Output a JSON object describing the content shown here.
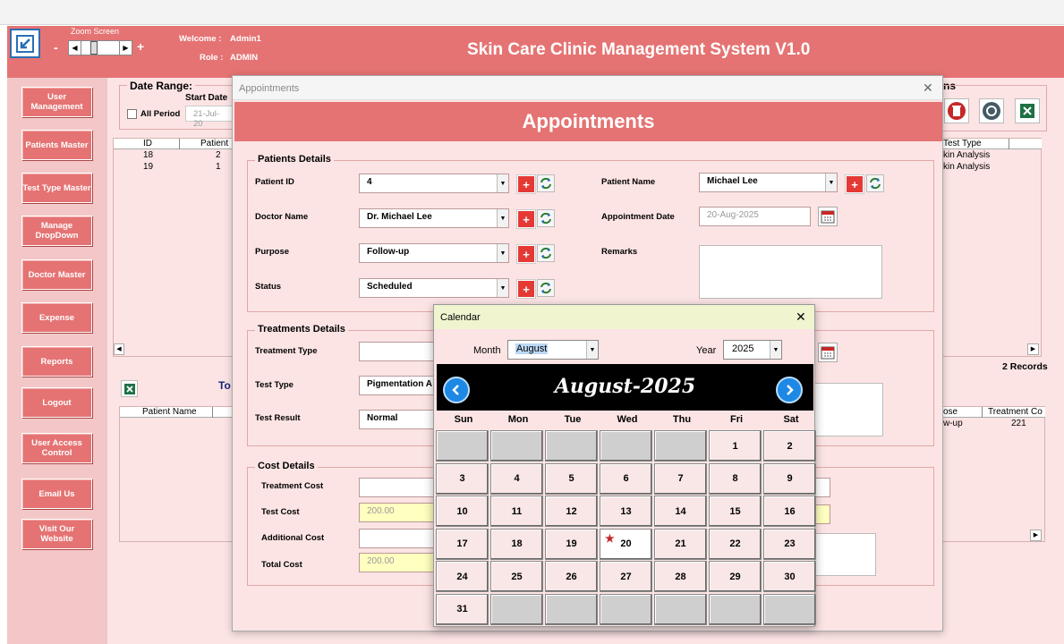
{
  "app": {
    "title": "Skin Care Clinic Management System V1.0",
    "zoom_label": "Zoom Screen",
    "zoom_minus": "-",
    "zoom_plus": "+",
    "welcome_label": "Welcome :",
    "welcome_user": "Admin1",
    "role_label": "Role :",
    "role_value": "ADMIN"
  },
  "sidebar": {
    "items": [
      {
        "label": "User Management"
      },
      {
        "label": "Patients Master"
      },
      {
        "label": "Test Type Master"
      },
      {
        "label": "Manage DropDown"
      },
      {
        "label": "Doctor Master"
      },
      {
        "label": "Expense"
      },
      {
        "label": "Reports"
      },
      {
        "label": "Logout"
      },
      {
        "label": "User Access Control"
      },
      {
        "label": "Email Us"
      },
      {
        "label": "Visit Our Website"
      }
    ]
  },
  "background": {
    "date_range_title": "Date Range:",
    "start_date_label": "Start Date",
    "all_period_label": "All Period",
    "start_date_value": "21-Jul-20",
    "table_headers": [
      "ID",
      "Patient"
    ],
    "rows": [
      [
        "18",
        "2"
      ],
      [
        "19",
        "1"
      ]
    ],
    "right_title_fragment": "ns",
    "right_header": "Test Type",
    "right_rows": [
      "kin Analysis",
      "kin Analysis"
    ],
    "records": "2 Records",
    "lower_title_fragment": "To",
    "lower_headers": [
      "Patient Name"
    ],
    "lower_right_headers": [
      "ose",
      "Treatment Co"
    ],
    "lower_right_rows": [
      [
        "w-up",
        "221"
      ]
    ]
  },
  "appt_window": {
    "title": "Appointments",
    "heading": "Appointments",
    "close": "✕",
    "patients": {
      "title": "Patients Details",
      "patient_id_label": "Patient ID",
      "patient_id": "4",
      "doctor_label": "Doctor Name",
      "doctor": "Dr. Michael Lee",
      "purpose_label": "Purpose",
      "purpose": "Follow-up",
      "status_label": "Status",
      "status": "Scheduled",
      "patient_name_label": "Patient Name",
      "patient_name": "Michael Lee",
      "appt_date_label": "Appointment Date",
      "appt_date": "20-Aug-2025",
      "remarks_label": "Remarks"
    },
    "treatments": {
      "title": "Treatments Details",
      "treatment_type_label": "Treatment Type",
      "test_type_label": "Test Type",
      "test_type": "Pigmentation A",
      "test_result_label": "Test Result",
      "test_result": "Normal"
    },
    "cost": {
      "title": "Cost Details",
      "treatment_cost_label": "Treatment Cost",
      "test_cost_label": "Test Cost",
      "test_cost": "200.00",
      "additional_cost_label": "Additional Cost",
      "total_cost_label": "Total Cost",
      "total_cost": "200.00"
    }
  },
  "calendar": {
    "title": "Calendar",
    "close": "✕",
    "month_label": "Month",
    "month": "August",
    "year_label": "Year",
    "year": "2025",
    "banner": "August-2025",
    "days": [
      "Sun",
      "Mon",
      "Tue",
      "Wed",
      "Thu",
      "Fri",
      "Sat"
    ],
    "marker": "★",
    "weeks": [
      [
        "",
        "",
        "",
        "",
        "",
        "1",
        "2"
      ],
      [
        "3",
        "4",
        "5",
        "6",
        "7",
        "8",
        "9"
      ],
      [
        "10",
        "11",
        "12",
        "13",
        "14",
        "15",
        "16"
      ],
      [
        "17",
        "18",
        "19",
        "20",
        "21",
        "22",
        "23"
      ],
      [
        "24",
        "25",
        "26",
        "27",
        "28",
        "29",
        "30"
      ],
      [
        "31",
        "",
        "",
        "",
        "",
        "",
        ""
      ]
    ]
  }
}
